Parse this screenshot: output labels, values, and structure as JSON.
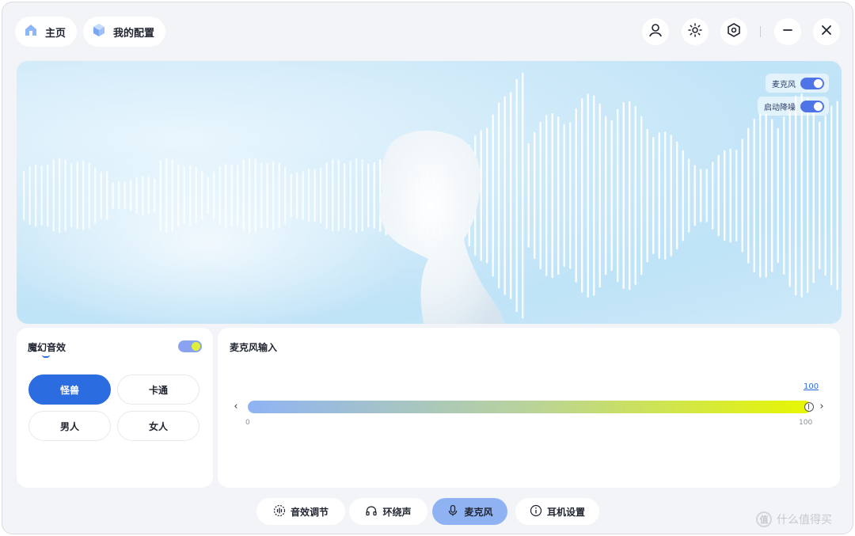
{
  "header": {
    "home_label": "主页",
    "config_label": "我的配置"
  },
  "hero": {
    "mic_toggle_label": "麦克风",
    "mic_toggle_on": true,
    "noise_toggle_label": "启动降噪",
    "noise_toggle_on": true
  },
  "voice_effects": {
    "title": "魔幻音效",
    "enabled": true,
    "options": [
      "怪兽",
      "卡通",
      "男人",
      "女人"
    ],
    "selected": "怪兽"
  },
  "mic_input": {
    "title": "麦克风输入",
    "value": 100,
    "value_label": "100",
    "min_label": "0",
    "max_label": "100"
  },
  "tabs": [
    {
      "label": "音效调节",
      "icon": "sound-effect-icon"
    },
    {
      "label": "环绕声",
      "icon": "headphones-icon"
    },
    {
      "label": "麦克风",
      "icon": "microphone-icon"
    },
    {
      "label": "耳机设置",
      "icon": "info-icon"
    }
  ],
  "active_tab": "麦克风",
  "watermark": {
    "text": "什么值得买",
    "icon_glyph": "值"
  },
  "colors": {
    "accent": "#2b6ce0",
    "active_tab": "#8fb3f2",
    "switch_on": "#4f74e8"
  }
}
